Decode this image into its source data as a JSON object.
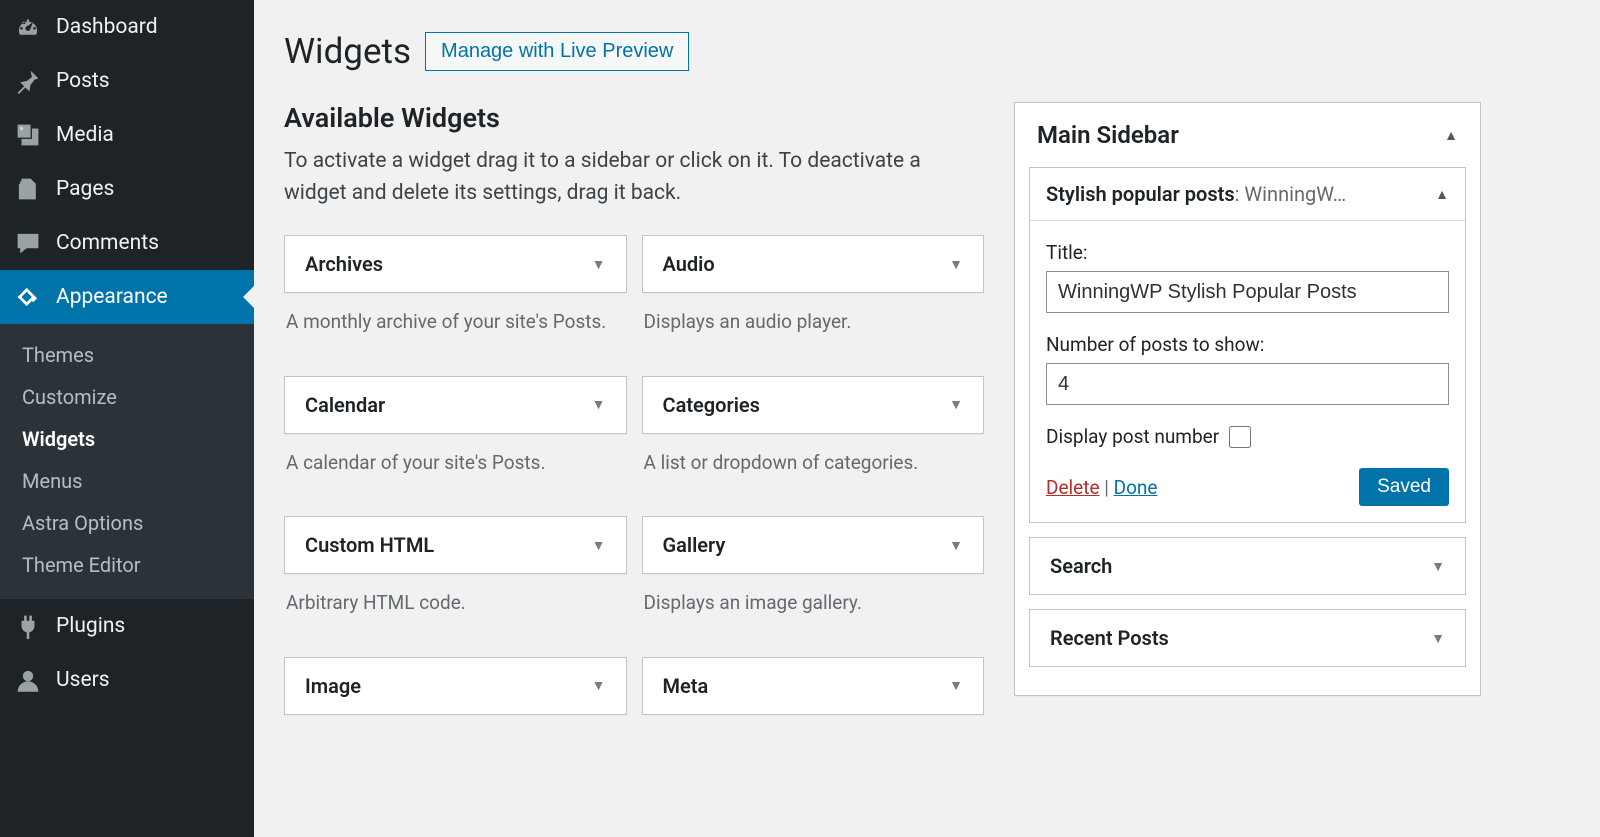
{
  "sidebar": {
    "items": [
      {
        "label": "Dashboard",
        "icon": "dashboard"
      },
      {
        "label": "Posts",
        "icon": "pin"
      },
      {
        "label": "Media",
        "icon": "media"
      },
      {
        "label": "Pages",
        "icon": "pages"
      },
      {
        "label": "Comments",
        "icon": "comments"
      },
      {
        "label": "Appearance",
        "icon": "appearance",
        "open": true
      },
      {
        "label": "Plugins",
        "icon": "plugins"
      },
      {
        "label": "Users",
        "icon": "users"
      }
    ],
    "submenu": [
      {
        "label": "Themes"
      },
      {
        "label": "Customize"
      },
      {
        "label": "Widgets",
        "current": true
      },
      {
        "label": "Menus"
      },
      {
        "label": "Astra Options"
      },
      {
        "label": "Theme Editor"
      }
    ]
  },
  "header": {
    "title": "Widgets",
    "action": "Manage with Live Preview"
  },
  "available": {
    "title": "Available Widgets",
    "description": "To activate a widget drag it to a sidebar or click on it. To deactivate a widget and delete its settings, drag it back.",
    "widgets": [
      {
        "title": "Archives",
        "desc": "A monthly archive of your site's Posts."
      },
      {
        "title": "Audio",
        "desc": "Displays an audio player."
      },
      {
        "title": "Calendar",
        "desc": "A calendar of your site's Posts."
      },
      {
        "title": "Categories",
        "desc": "A list or dropdown of categories."
      },
      {
        "title": "Custom HTML",
        "desc": "Arbitrary HTML code."
      },
      {
        "title": "Gallery",
        "desc": "Displays an image gallery."
      },
      {
        "title": "Image",
        "desc": ""
      },
      {
        "title": "Meta",
        "desc": ""
      }
    ]
  },
  "area": {
    "title": "Main Sidebar",
    "open_widget": {
      "name": "Stylish popular posts",
      "subtitle": ": WinningW…",
      "form": {
        "title_label": "Title:",
        "title_value": "WinningWP Stylish Popular Posts",
        "count_label": "Number of posts to show:",
        "count_value": "4",
        "display_num_label": "Display post number",
        "delete": "Delete",
        "sep": " | ",
        "done": "Done",
        "saved": "Saved"
      }
    },
    "collapsed": [
      {
        "title": "Search"
      },
      {
        "title": "Recent Posts"
      }
    ]
  }
}
